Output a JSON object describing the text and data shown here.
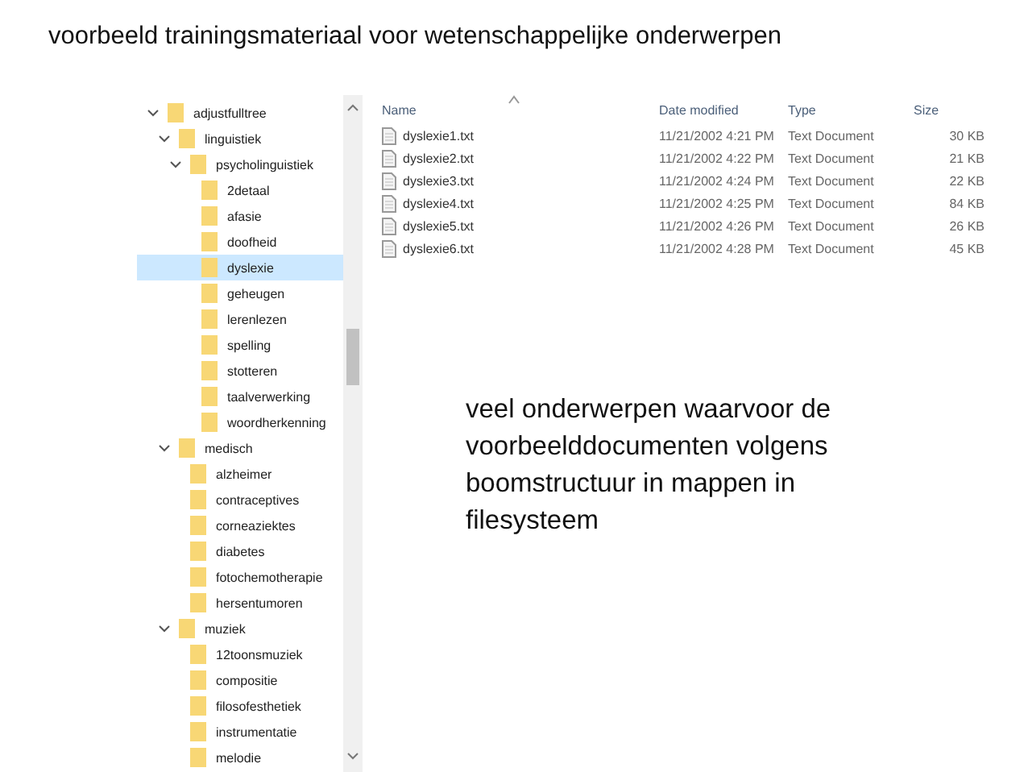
{
  "title": "voorbeeld trainingsmateriaal voor wetenschappelijke onderwerpen",
  "tree": [
    {
      "label": "adjustfulltree",
      "expanded": true,
      "selected": false,
      "children": [
        {
          "label": "linguistiek",
          "expanded": true,
          "selected": false,
          "children": [
            {
              "label": "psycholinguistiek",
              "expanded": true,
              "selected": false,
              "children": [
                {
                  "label": "2detaal",
                  "selected": false
                },
                {
                  "label": "afasie",
                  "selected": false
                },
                {
                  "label": "doofheid",
                  "selected": false
                },
                {
                  "label": "dyslexie",
                  "selected": true
                },
                {
                  "label": "geheugen",
                  "selected": false
                },
                {
                  "label": "lerenlezen",
                  "selected": false
                },
                {
                  "label": "spelling",
                  "selected": false
                },
                {
                  "label": "stotteren",
                  "selected": false
                },
                {
                  "label": "taalverwerking",
                  "selected": false
                },
                {
                  "label": "woordherkenning",
                  "selected": false
                }
              ]
            }
          ]
        },
        {
          "label": "medisch",
          "expanded": true,
          "selected": false,
          "children": [
            {
              "label": "alzheimer",
              "selected": false
            },
            {
              "label": "contraceptives",
              "selected": false
            },
            {
              "label": "corneaziektes",
              "selected": false
            },
            {
              "label": "diabetes",
              "selected": false
            },
            {
              "label": "fotochemotherapie",
              "selected": false
            },
            {
              "label": "hersentumoren",
              "selected": false
            }
          ]
        },
        {
          "label": "muziek",
          "expanded": true,
          "selected": false,
          "children": [
            {
              "label": "12toonsmuziek",
              "selected": false
            },
            {
              "label": "compositie",
              "selected": false
            },
            {
              "label": "filosofesthetiek",
              "selected": false
            },
            {
              "label": "instrumentatie",
              "selected": false
            },
            {
              "label": "melodie",
              "selected": false
            }
          ]
        }
      ]
    }
  ],
  "file_list": {
    "columns": [
      "Name",
      "Date modified",
      "Type",
      "Size"
    ],
    "rows": [
      [
        "dyslexie1.txt",
        "11/21/2002 4:21 PM",
        "Text Document",
        "30 KB"
      ],
      [
        "dyslexie2.txt",
        "11/21/2002 4:22 PM",
        "Text Document",
        "21 KB"
      ],
      [
        "dyslexie3.txt",
        "11/21/2002 4:24 PM",
        "Text Document",
        "22 KB"
      ],
      [
        "dyslexie4.txt",
        "11/21/2002 4:25 PM",
        "Text Document",
        "84 KB"
      ],
      [
        "dyslexie5.txt",
        "11/21/2002 4:26 PM",
        "Text Document",
        "26 KB"
      ],
      [
        "dyslexie6.txt",
        "11/21/2002 4:28 PM",
        "Text Document",
        "45 KB"
      ]
    ]
  },
  "note": "veel onderwerpen waarvoor de voorbeelddocumenten volgens boomstructuur in mappen in filesysteem"
}
